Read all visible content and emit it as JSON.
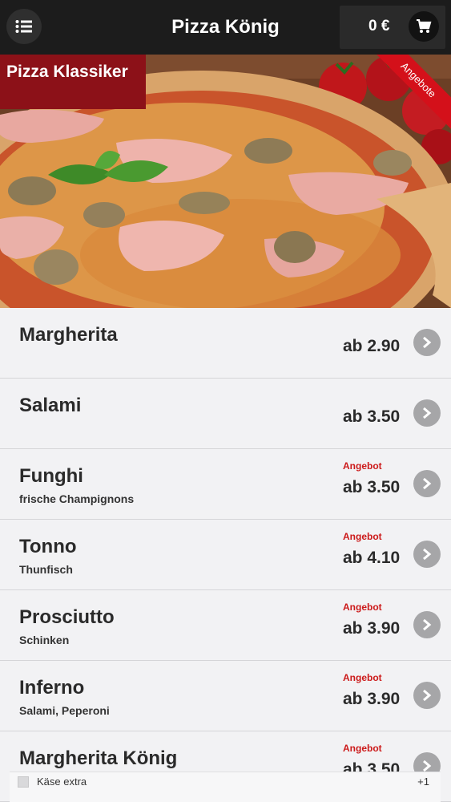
{
  "header": {
    "title": "Pizza König",
    "cart_total": "0 €"
  },
  "hero": {
    "category": "Pizza Klassiker",
    "ribbon": "Angebote"
  },
  "items": [
    {
      "name": "Margherita",
      "desc": "",
      "offer": "",
      "price": "ab 2.90"
    },
    {
      "name": "Salami",
      "desc": "",
      "offer": "",
      "price": "ab 3.50"
    },
    {
      "name": "Funghi",
      "desc": "frische Champignons",
      "offer": "Angebot",
      "price": "ab 3.50"
    },
    {
      "name": "Tonno",
      "desc": "Thunfisch",
      "offer": "Angebot",
      "price": "ab 4.10"
    },
    {
      "name": "Prosciutto",
      "desc": "Schinken",
      "offer": "Angebot",
      "price": "ab 3.90"
    },
    {
      "name": "Inferno",
      "desc": "Salami, Peperoni",
      "offer": "Angebot",
      "price": "ab 3.90"
    },
    {
      "name": "Margherita König",
      "desc": "",
      "offer": "Angebot",
      "price": "ab 3.50"
    }
  ],
  "option": {
    "label": "Käse extra",
    "price": "+1"
  },
  "colors": {
    "header_bg": "#1c1c1c",
    "category_bg": "#8c1118",
    "ribbon_bg": "#d4101a",
    "offer_text": "#cc1a1a"
  }
}
